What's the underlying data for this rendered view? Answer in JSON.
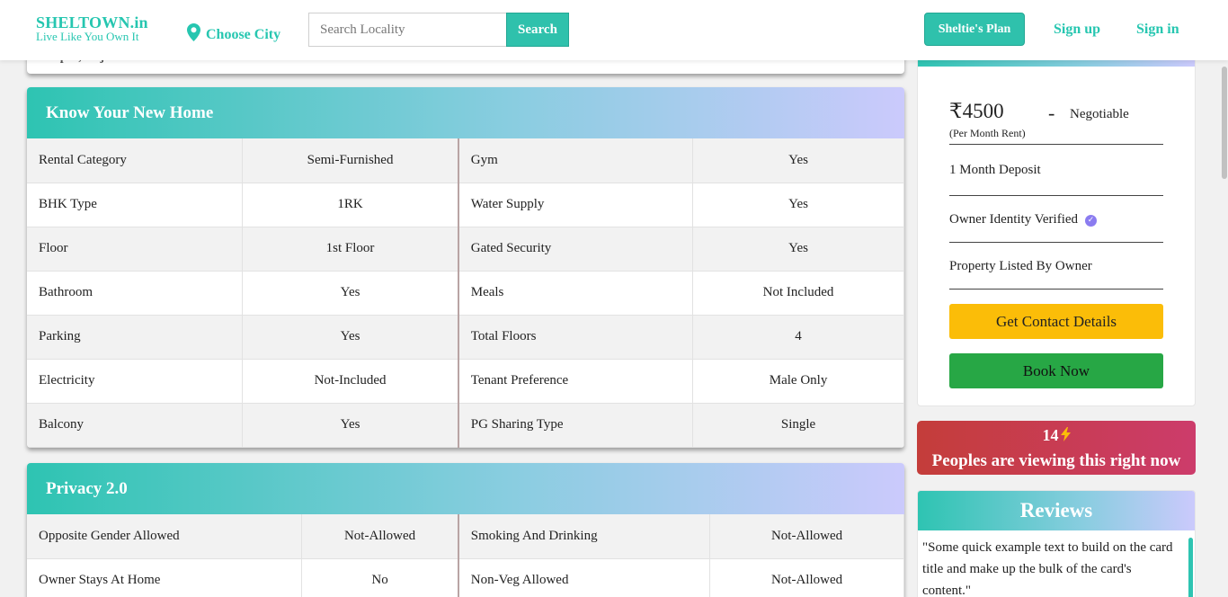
{
  "navbar": {
    "brand_name": "SHELTOWN.in",
    "brand_tagline": "Live Like You Own It",
    "city_label": "Choose City",
    "search_placeholder": "Search Locality",
    "search_button": "Search",
    "plan_button": "Sheltie's Plan",
    "signup": "Sign up",
    "signin": "Sign in",
    "accent_color": "#2fc1ac"
  },
  "previous_card": {
    "address": "Udaipur, Rajasthan"
  },
  "know_home": {
    "title": "Know Your New Home",
    "rows": [
      {
        "l1": "Rental Category",
        "v1": "Semi-Furnished",
        "l2": "Gym",
        "v2": "Yes"
      },
      {
        "l1": "BHK Type",
        "v1": "1RK",
        "l2": "Water Supply",
        "v2": "Yes"
      },
      {
        "l1": "Floor",
        "v1": "1st Floor",
        "l2": "Gated Security",
        "v2": "Yes"
      },
      {
        "l1": "Bathroom",
        "v1": "Yes",
        "l2": "Meals",
        "v2": "Not Included"
      },
      {
        "l1": "Parking",
        "v1": "Yes",
        "l2": "Total Floors",
        "v2": "4"
      },
      {
        "l1": "Electricity",
        "v1": "Not-Included",
        "l2": "Tenant Preference",
        "v2": "Male Only"
      },
      {
        "l1": "Balcony",
        "v1": "Yes",
        "l2": "PG Sharing Type",
        "v2": "Single"
      }
    ]
  },
  "privacy": {
    "title": "Privacy 2.0",
    "rows": [
      {
        "l1": "Opposite Gender Allowed",
        "v1": "Not-Allowed",
        "l2": "Smoking And Drinking",
        "v2": "Not-Allowed"
      },
      {
        "l1": "Owner Stays At Home",
        "v1": "No",
        "l2": "Non-Veg Allowed",
        "v2": "Not-Allowed"
      }
    ]
  },
  "pricing": {
    "price": "₹4500",
    "separator": "-",
    "negotiable": "Negotiable",
    "per_month": "(Per Month Rent)",
    "deposit": "1 Month Deposit",
    "owner_verified": "Owner Identity Verified",
    "listed_by": "Property Listed By Owner",
    "contact_button": "Get Contact Details",
    "book_button": "Book Now"
  },
  "viewers": {
    "count": "14",
    "text": "Peoples are viewing this right now"
  },
  "reviews": {
    "title": "Reviews",
    "text": "\"Some quick example text to build on the card title and make up the bulk of the card's content.\""
  }
}
